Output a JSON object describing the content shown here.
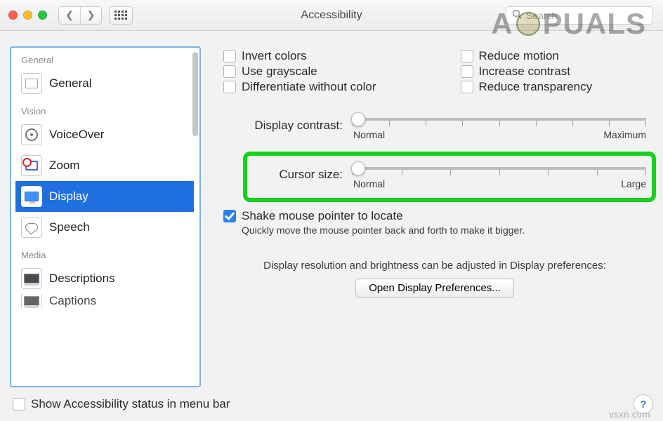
{
  "window": {
    "title": "Accessibility",
    "search_placeholder": "Search"
  },
  "sidebar": {
    "groups": [
      {
        "label": "General",
        "items": [
          {
            "id": "general",
            "label": "General"
          }
        ]
      },
      {
        "label": "Vision",
        "items": [
          {
            "id": "voiceover",
            "label": "VoiceOver"
          },
          {
            "id": "zoom",
            "label": "Zoom"
          },
          {
            "id": "display",
            "label": "Display",
            "selected": true
          },
          {
            "id": "speech",
            "label": "Speech"
          }
        ]
      },
      {
        "label": "Media",
        "items": [
          {
            "id": "descriptions",
            "label": "Descriptions"
          },
          {
            "id": "captions",
            "label": "Captions"
          }
        ]
      }
    ]
  },
  "options": {
    "left": [
      {
        "id": "invert",
        "label": "Invert colors",
        "checked": false
      },
      {
        "id": "grayscale",
        "label": "Use grayscale",
        "checked": false
      },
      {
        "id": "diffcolor",
        "label": "Differentiate without color",
        "checked": false
      }
    ],
    "right": [
      {
        "id": "motion",
        "label": "Reduce motion",
        "checked": false
      },
      {
        "id": "contrast",
        "label": "Increase contrast",
        "checked": false
      },
      {
        "id": "transp",
        "label": "Reduce transparency",
        "checked": false
      }
    ]
  },
  "sliders": {
    "contrast": {
      "label": "Display contrast:",
      "min_label": "Normal",
      "max_label": "Maximum",
      "value_pct": 0
    },
    "cursor": {
      "label": "Cursor size:",
      "min_label": "Normal",
      "max_label": "Large",
      "value_pct": 0
    }
  },
  "shake": {
    "label": "Shake mouse pointer to locate",
    "checked": true,
    "sub": "Quickly move the mouse pointer back and forth to make it bigger."
  },
  "resolution_note": "Display resolution and brightness can be adjusted in Display preferences:",
  "open_display_btn": "Open Display Preferences...",
  "footer": {
    "show_status_label": "Show Accessibility status in menu bar",
    "show_status_checked": false
  },
  "watermarks": {
    "brand_prefix": "A",
    "brand_suffix": "PUALS",
    "source": "vsxn.com"
  }
}
